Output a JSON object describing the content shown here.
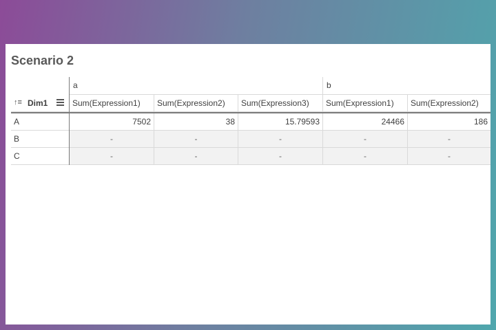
{
  "sheet": {
    "title": "Scenario 2"
  },
  "table": {
    "dimension_header": {
      "label": "Dim1",
      "sort_icon": "sort-ascending-icon",
      "menu_icon": "hamburger-menu-icon"
    },
    "groups": [
      {
        "label": "a",
        "measures": [
          "Sum(Expression1)",
          "Sum(Expression2)",
          "Sum(Expression3)"
        ]
      },
      {
        "label": "b",
        "measures": [
          "Sum(Expression1)",
          "Sum(Expression2)"
        ]
      }
    ],
    "rows": [
      {
        "label": "A",
        "values": [
          "7502",
          "38",
          "15.79593",
          "24466",
          "186"
        ]
      },
      {
        "label": "B",
        "values": [
          "-",
          "-",
          "-",
          "-",
          "-"
        ]
      },
      {
        "label": "C",
        "values": [
          "-",
          "-",
          "-",
          "-",
          "-"
        ]
      }
    ]
  }
}
